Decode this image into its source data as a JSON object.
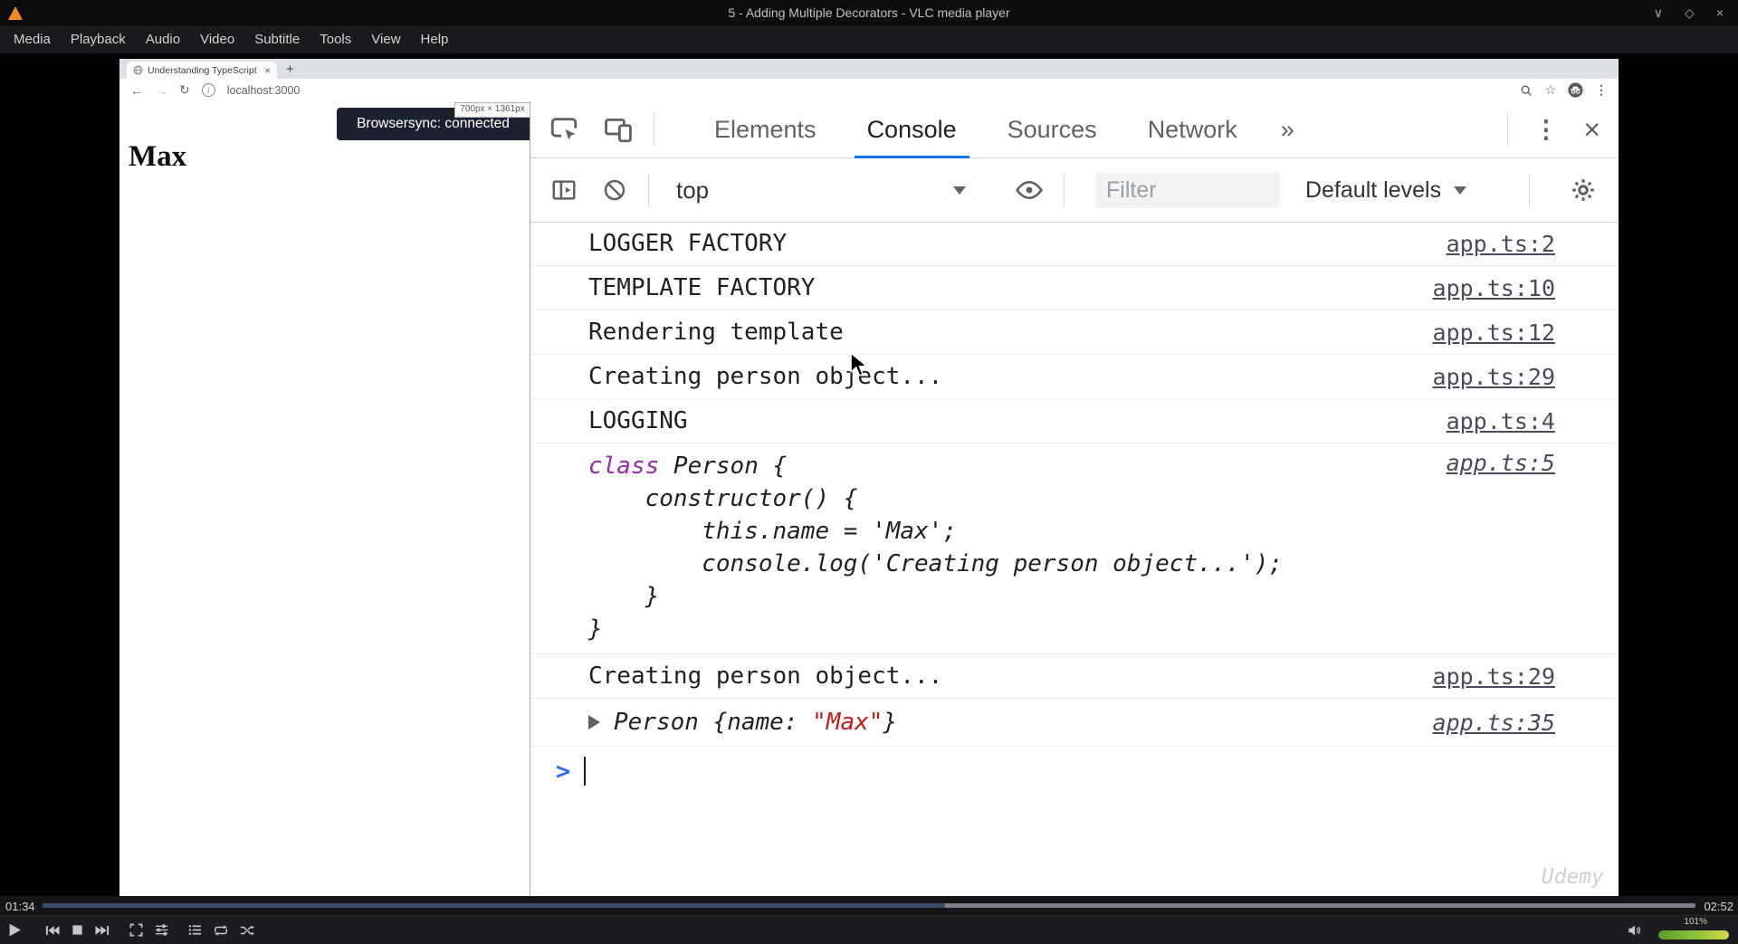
{
  "window": {
    "title": "5 - Adding Multiple Decorators - VLC media player"
  },
  "menu_bar": {
    "items": [
      "Media",
      "Playback",
      "Audio",
      "Video",
      "Subtitle",
      "Tools",
      "View",
      "Help"
    ]
  },
  "player": {
    "elapsed": "01:34",
    "duration": "02:52",
    "seek_percent": 54.6,
    "volume_percent_label": "101%"
  },
  "browser": {
    "tab_title": "Understanding TypeScript",
    "url": "localhost:3000",
    "page_heading": "Max",
    "browsersync_status": "Browsersync: connected",
    "viewport_tooltip": "700px × 1361px",
    "watermark": "Udemy"
  },
  "devtools": {
    "tabs": {
      "elements": "Elements",
      "console": "Console",
      "sources": "Sources",
      "network": "Network"
    },
    "active_tab": "Console",
    "toolbar": {
      "frame_context": "top",
      "filter_placeholder": "Filter",
      "log_levels": "Default levels"
    },
    "console_messages": [
      {
        "text": "LOGGER FACTORY",
        "source": "app.ts:2"
      },
      {
        "text": "TEMPLATE FACTORY",
        "source": "app.ts:10"
      },
      {
        "text": "Rendering template",
        "source": "app.ts:12"
      },
      {
        "text": "Creating person object...",
        "source": "app.ts:29"
      },
      {
        "text": "LOGGING",
        "source": "app.ts:4"
      },
      {
        "keyword": "class",
        "code_rest": " Person {",
        "code_lines": [
          "    constructor() {",
          "        this.name = 'Max';",
          "        console.log('Creating person object...');",
          "    }",
          "}"
        ],
        "source": "app.ts:5"
      },
      {
        "text": "Creating person object...",
        "source": "app.ts:29"
      },
      {
        "object_prefix": "Person {name: ",
        "object_string": "\"Max\"",
        "object_suffix": "}",
        "source": "app.ts:35"
      }
    ]
  },
  "icons": {
    "back": "←",
    "forward": "→",
    "reload": "↻",
    "info": "i",
    "star": "☆",
    "kebab_menu": "⋮",
    "close": "×",
    "more_tabs": "»",
    "new_tab": "+",
    "tab_close": "×",
    "window_minimize": "∨",
    "window_maximize": "◇",
    "window_close": "×",
    "prompt_chevron": ">"
  },
  "colors": {
    "accent_blue": "#1a73e8",
    "prompt_blue": "#2d6cf5",
    "keyword_purple": "#9c27b0",
    "string_red": "#c41a16",
    "link_gray": "#474b5c",
    "seek_fill": "#3c4d68",
    "browsersync_bg": "#1c2130",
    "volume_green": "#5c9c2e",
    "volume_yellow": "#d6d94f"
  }
}
